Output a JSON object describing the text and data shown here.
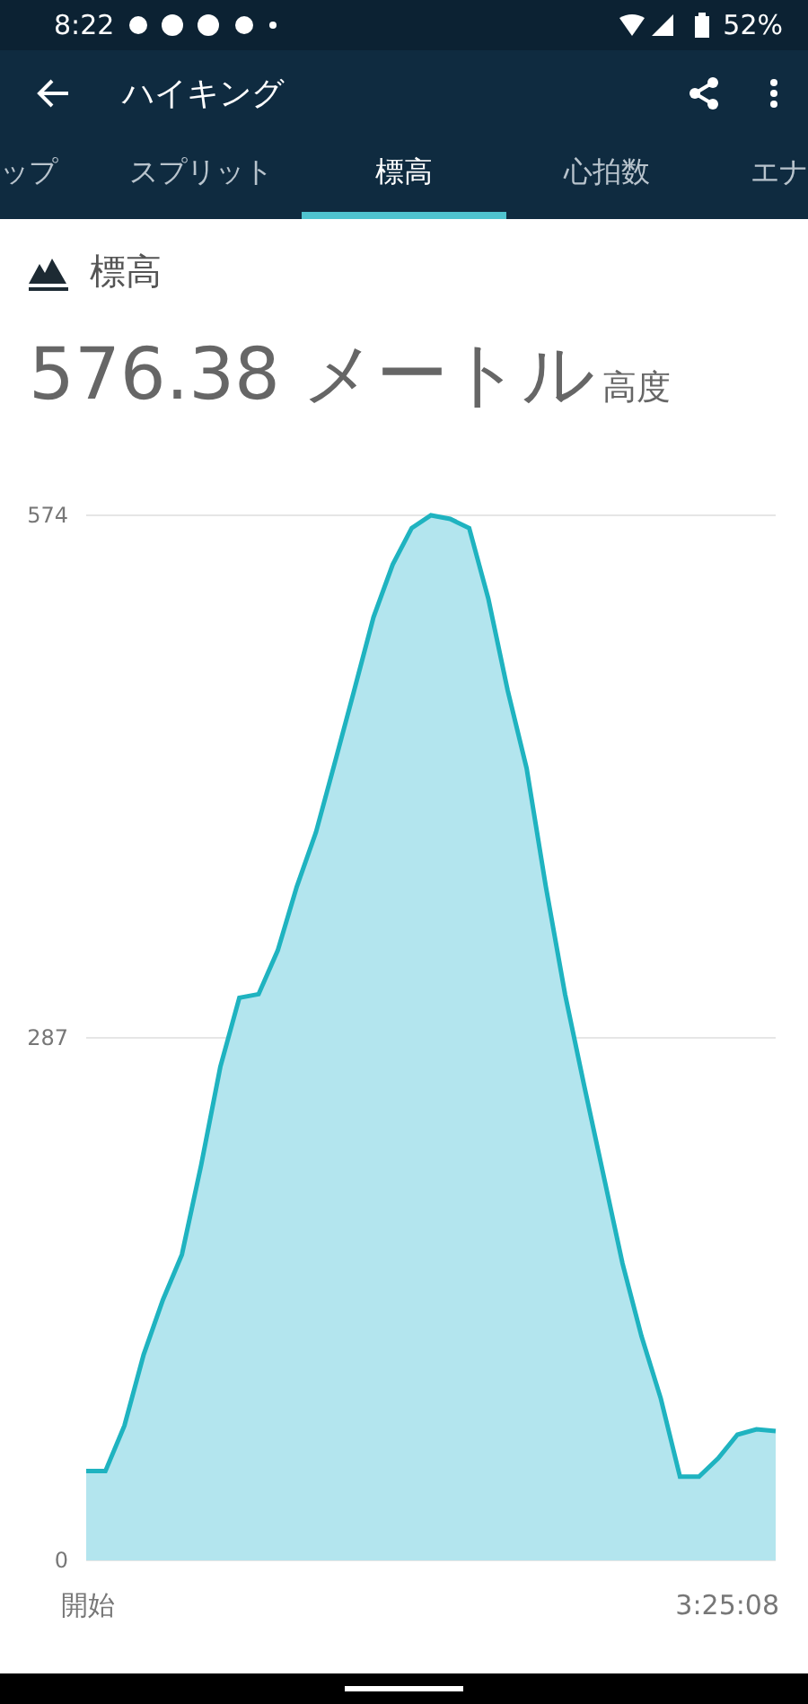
{
  "status_bar": {
    "time": "8:22",
    "battery": "52%"
  },
  "app_bar": {
    "title": "ハイキング"
  },
  "tabs": [
    {
      "label": "ップ",
      "selected": false
    },
    {
      "label": "スプリット",
      "selected": false
    },
    {
      "label": "標高",
      "selected": true
    },
    {
      "label": "心拍数",
      "selected": false
    },
    {
      "label": "エナ",
      "selected": false
    }
  ],
  "section": {
    "title": "標高"
  },
  "summary": {
    "value": "576.38 メートル",
    "caption": "高度"
  },
  "x_axis": {
    "start": "開始",
    "end": "3:25:08"
  },
  "chart_data": {
    "type": "area",
    "ylim": [
      0,
      574
    ],
    "yticks": [
      0,
      287,
      574
    ],
    "series": [
      {
        "color": "#1fb3c0",
        "values": [
          49,
          49,
          74,
          113,
          143,
          168,
          217,
          271,
          309,
          311,
          335,
          370,
          400,
          439,
          478,
          518,
          547,
          567,
          574,
          572,
          567,
          528,
          478,
          435,
          370,
          311,
          261,
          212,
          163,
          123,
          89,
          46,
          46,
          56,
          69,
          72,
          71
        ]
      }
    ]
  }
}
